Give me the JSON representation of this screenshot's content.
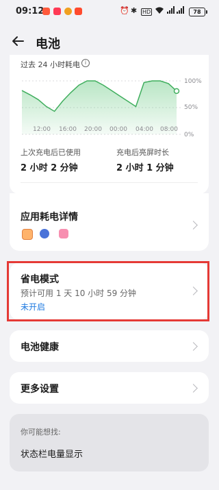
{
  "status_bar": {
    "time": "09:12",
    "right_labels": {
      "hd": "HD",
      "battery": "78"
    }
  },
  "header": {
    "back_icon": "arrow-left",
    "title": "电池"
  },
  "usage_card": {
    "chart_title": "过去 24 小时耗电",
    "info_icon": "info-circle",
    "chart_data": {
      "type": "area",
      "x_ticks": [
        "12:00",
        "16:00",
        "20:00",
        "00:00",
        "04:00",
        "08:00"
      ],
      "y_ticks": [
        "100%",
        "50%",
        "0%"
      ],
      "ylim": [
        0,
        100
      ],
      "series": [
        {
          "values": [
            {
              "x": "09:00",
              "y": 82
            },
            {
              "x": "10:00",
              "y": 74
            },
            {
              "x": "12:00",
              "y": 65
            },
            {
              "x": "14:00",
              "y": 52
            },
            {
              "x": "15:00",
              "y": 43
            },
            {
              "x": "16:00",
              "y": 62
            },
            {
              "x": "17:00",
              "y": 78
            },
            {
              "x": "18:00",
              "y": 92
            },
            {
              "x": "19:00",
              "y": 100
            },
            {
              "x": "20:00",
              "y": 100
            },
            {
              "x": "21:00",
              "y": 92
            },
            {
              "x": "22:00",
              "y": 82
            },
            {
              "x": "23:00",
              "y": 72
            },
            {
              "x": "00:00",
              "y": 62
            },
            {
              "x": "02:00",
              "y": 52
            },
            {
              "x": "03:00",
              "y": 97
            },
            {
              "x": "04:00",
              "y": 100
            },
            {
              "x": "06:00",
              "y": 100
            },
            {
              "x": "08:00",
              "y": 95
            },
            {
              "x": "09:00",
              "y": 81
            }
          ]
        }
      ]
    },
    "stats": [
      {
        "label": "上次充电后已使用",
        "value": "2 小时 2 分钟"
      },
      {
        "label": "充电后亮屏时长",
        "value": "2 小时 1 分钟"
      }
    ]
  },
  "app_usage": {
    "title": "应用耗电详情",
    "app_icons": [
      "app-icon-1",
      "app-icon-2",
      "app-icon-3"
    ]
  },
  "power_saving": {
    "title": "省电模式",
    "subtitle": "预计可用 1 天 10 小时 59 分钟",
    "status": "未开启"
  },
  "battery_health": {
    "title": "电池健康"
  },
  "more_settings": {
    "title": "更多设置"
  },
  "suggestion": {
    "heading": "你可能想找:",
    "item": "状态栏电量显示"
  },
  "colors": {
    "accent_green": "#3fae5d",
    "accent_blue": "#1f7ae0",
    "highlight_red": "#e53935"
  }
}
